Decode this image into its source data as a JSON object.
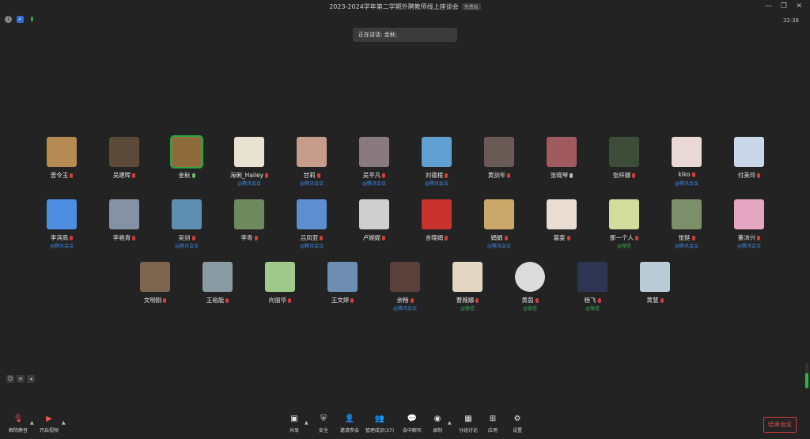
{
  "window": {
    "title": "2023-2024学年第二学期外聘教师线上座谈会",
    "tag": "免费版",
    "timer": "32:38"
  },
  "speaking": "正在讲话: 金秋;",
  "participants": [
    {
      "name": "曾令玉",
      "src": "",
      "mic": "muted",
      "col": "#b58a55"
    },
    {
      "name": "吴建晖",
      "src": "",
      "mic": "muted",
      "col": "#5b4a3a"
    },
    {
      "name": "金秋",
      "src": "",
      "mic": "on",
      "col": "#8d6b3a",
      "active": true
    },
    {
      "name": "海俐_Hailey",
      "src": "@腾讯会议",
      "mic": "muted",
      "col": "#e8e2d2"
    },
    {
      "name": "甘莉",
      "src": "@腾讯会议",
      "mic": "muted",
      "col": "#c69c8a"
    },
    {
      "name": "吴平凡",
      "src": "@腾讯会议",
      "mic": "muted",
      "col": "#8a7a80"
    },
    {
      "name": "刘德根",
      "src": "@腾讯会议",
      "mic": "muted",
      "col": "#5f9fd1"
    },
    {
      "name": "黄剑年",
      "src": "",
      "mic": "muted",
      "col": "#6a5a55"
    },
    {
      "name": "张晓琴",
      "src": "",
      "mic": "grey",
      "col": "#a15a5f"
    },
    {
      "name": "张梓娜",
      "src": "",
      "mic": "muted",
      "col": "#3d4d3a"
    },
    {
      "name": "kiko",
      "src": "@腾讯会议",
      "mic": "muted",
      "col": "#e9d8d4"
    },
    {
      "name": "付美玲",
      "src": "",
      "mic": "muted",
      "col": "#c9d7e8"
    },
    {
      "name": "李滨高",
      "src": "@腾讯会议",
      "mic": "muted",
      "col": "#4d8ee3"
    },
    {
      "name": "李艳青",
      "src": "",
      "mic": "muted",
      "col": "#8393a3"
    },
    {
      "name": "吴剑",
      "src": "@腾讯会议",
      "mic": "muted",
      "col": "#5e8fb0"
    },
    {
      "name": "李青",
      "src": "",
      "mic": "muted",
      "col": "#6f8a5f"
    },
    {
      "name": "吕凤亚",
      "src": "@腾讯会议",
      "mic": "muted",
      "col": "#5c8ed0"
    },
    {
      "name": "卢婉妮",
      "src": "",
      "mic": "muted",
      "col": "#cfcfcf"
    },
    {
      "name": "言晓娟",
      "src": "",
      "mic": "muted",
      "col": "#c8342d"
    },
    {
      "name": "娟娟",
      "src": "@腾讯会议",
      "mic": "muted",
      "col": "#c9a86a"
    },
    {
      "name": "葛斐",
      "src": "",
      "mic": "muted",
      "col": "#e9ddd3"
    },
    {
      "name": "那一个人",
      "src": "@微信",
      "mic": "muted",
      "col": "#d2dc9c",
      "wx": true
    },
    {
      "name": "张挺",
      "src": "@腾讯会议",
      "mic": "muted",
      "col": "#7a8f6a"
    },
    {
      "name": "董沛兴",
      "src": "@腾讯会议",
      "mic": "muted",
      "col": "#e4a6c0"
    },
    {
      "name": "文明刚",
      "src": "",
      "mic": "muted",
      "col": "#7d6550"
    },
    {
      "name": "王裕能",
      "src": "",
      "mic": "muted",
      "col": "#8a9aa3"
    },
    {
      "name": "向丽华",
      "src": "",
      "mic": "muted",
      "col": "#9fc98a"
    },
    {
      "name": "王文婷",
      "src": "",
      "mic": "muted",
      "col": "#6d8db3"
    },
    {
      "name": "余畅",
      "src": "@腾讯会议",
      "mic": "muted",
      "col": "#5a3f3a"
    },
    {
      "name": "曹薇娜",
      "src": "@微信",
      "mic": "muted",
      "col": "#e3d6c2",
      "wx": true
    },
    {
      "name": "黄茵",
      "src": "@微信",
      "mic": "muted",
      "col": "#dcdcdc",
      "wx": true,
      "circle": true
    },
    {
      "name": "杨飞",
      "src": "@微信",
      "mic": "muted",
      "col": "#2d3553",
      "wx": true
    },
    {
      "name": "黄慧",
      "src": "",
      "mic": "muted",
      "col": "#b9cbd6"
    }
  ],
  "toolbar": {
    "left": [
      {
        "label": "解除静音",
        "icon": "mic-off-icon"
      },
      {
        "label": "开启视频",
        "icon": "video-off-icon"
      }
    ],
    "center": [
      {
        "label": "共享",
        "icon": "share-screen-icon"
      },
      {
        "label": "安全",
        "icon": "shield-icon"
      },
      {
        "label": "邀请参会",
        "icon": "invite-icon"
      },
      {
        "label": "管理成员(37)",
        "icon": "members-icon"
      },
      {
        "label": "会中聊天",
        "icon": "chat-icon"
      },
      {
        "label": "录制",
        "icon": "record-icon"
      },
      {
        "label": "分组讨论",
        "icon": "breakout-icon"
      },
      {
        "label": "应用",
        "icon": "apps-icon"
      },
      {
        "label": "设置",
        "icon": "settings-icon"
      }
    ],
    "end": "结束会议"
  },
  "volume_level": 0.6
}
